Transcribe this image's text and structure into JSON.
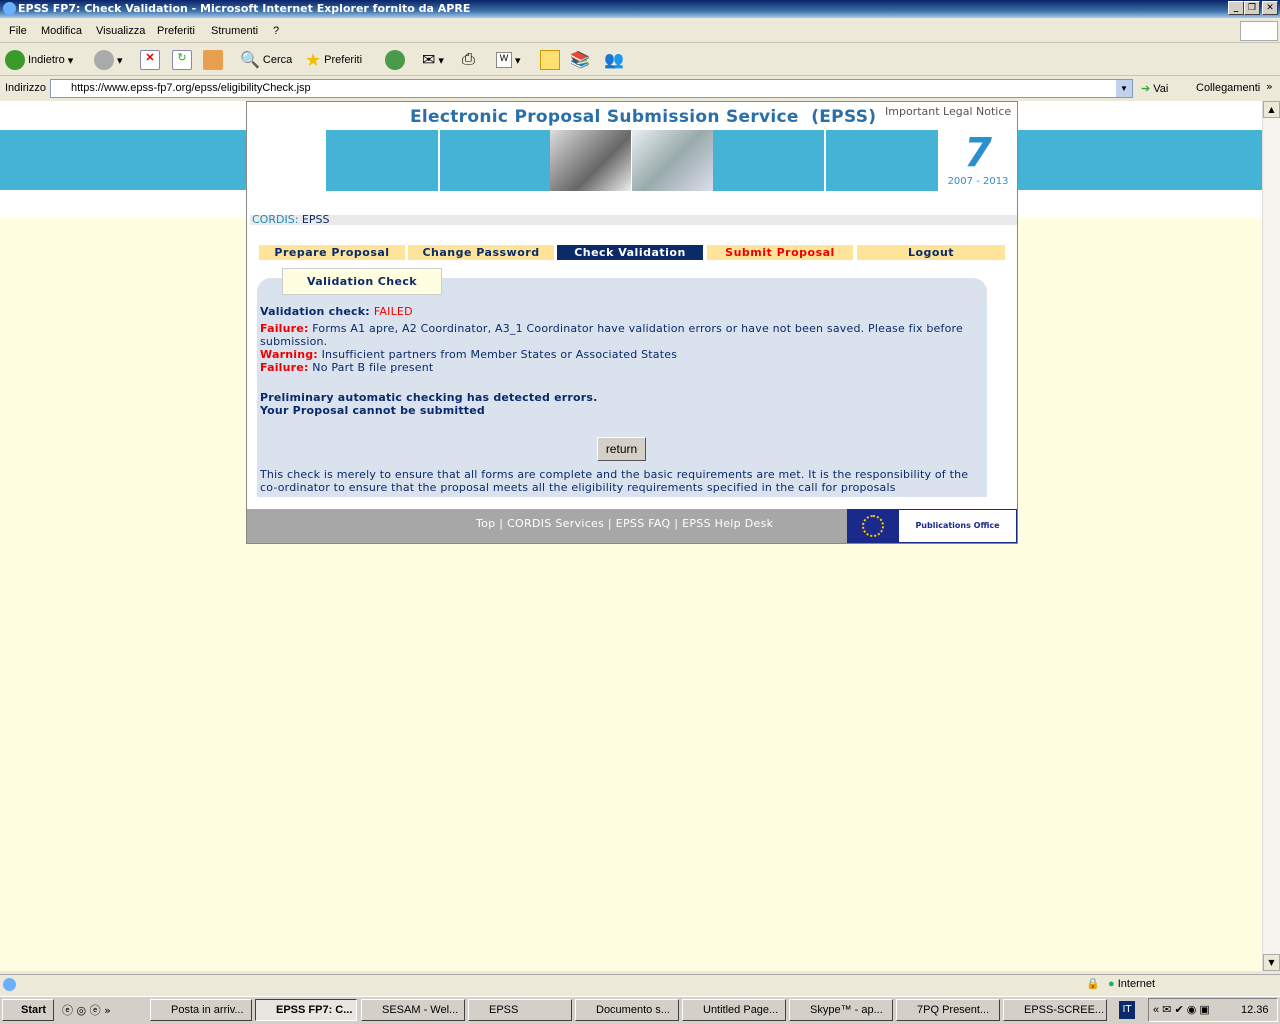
{
  "window": {
    "title": "EPSS FP7: Check Validation - Microsoft Internet Explorer fornito da APRE"
  },
  "menu": [
    "File",
    "Modifica",
    "Visualizza",
    "Preferiti",
    "Strumenti",
    "?"
  ],
  "toolbar": {
    "back": "Indietro",
    "search": "Cerca",
    "favorites": "Preferiti"
  },
  "address": {
    "label": "Indirizzo",
    "url": "https://www.epss-fp7.org/epss/eligibilityCheck.jsp",
    "go": "Vai",
    "links": "Collegamenti"
  },
  "page": {
    "title": "Electronic Proposal Submission Service  (EPSS)",
    "legal": "Important Legal Notice",
    "logo_years": "2007 - 2013",
    "breadcrumb": {
      "cordis": "CORDIS",
      "sep": ":",
      "epss": "EPSS"
    },
    "nav": [
      "Prepare Proposal",
      "Change Password",
      "Check Validation",
      "Submit Proposal",
      "Logout"
    ],
    "tab": "Validation Check",
    "result_label": "Validation check:",
    "result": "FAILED",
    "messages": [
      {
        "type": "Failure:",
        "text": "Forms A1 apre, A2 Coordinator, A3_1 Coordinator have validation errors or have not been saved. Please fix before submission."
      },
      {
        "type": "Warning:",
        "text": "Insufficient partners from Member States or Associated States"
      },
      {
        "type": "Failure:",
        "text": "No Part B file present"
      }
    ],
    "summary1": "Preliminary automatic checking has detected errors.",
    "summary2": "Your Proposal cannot be submitted",
    "return_button": "return",
    "disclaimer": "This check is merely to ensure that all forms are complete and the basic requirements are met. It is the responsibility of the co-ordinator to ensure that the proposal meets all the eligibility requirements specified in the call for proposals",
    "footer_links": [
      "Top",
      "CORDIS Services",
      "EPSS FAQ",
      "EPSS Help Desk"
    ],
    "publications": "Publications Office"
  },
  "status": {
    "zone": "Internet"
  },
  "taskbar": {
    "start": "Start",
    "tasks": [
      "Posta in arriv...",
      "EPSS FP7: C...",
      "SESAM - Wel...",
      "EPSS",
      "Documento s...",
      "Untitled Page...",
      "Skype™ - ap...",
      "7PQ Present...",
      "EPSS-SCREE..."
    ],
    "lang": "IT",
    "clock": "12.36"
  },
  "colors": {
    "nav_bg": "#fde49a",
    "nav_active": "#0a2a6a",
    "error": "#ee0000",
    "banner": "#45b3d6",
    "panel": "#dae2ed"
  }
}
